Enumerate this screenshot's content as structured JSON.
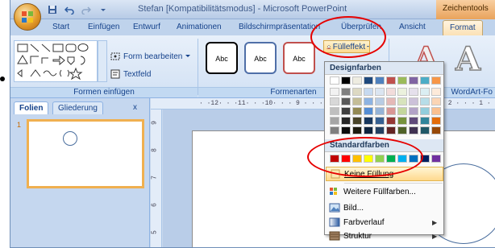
{
  "titlebar": {
    "window_title": "Stefan [Kompatibilitätsmodus] - Microsoft PowerPoint",
    "context_group": "Zeichentools"
  },
  "tabs": [
    "Start",
    "Einfügen",
    "Entwurf",
    "Animationen",
    "Bildschirmpräsentation",
    "Überprüfen",
    "Ansicht",
    "Format"
  ],
  "ribbon": {
    "shapes_group_label": "Formen einfügen",
    "edit_shape": "Form bearbeiten",
    "textbox": "Textfeld",
    "styles_group_label": "Formenarten",
    "style_samples": [
      "Abc",
      "Abc",
      "Abc"
    ],
    "fill_button": "Fülleffekt",
    "wordart_group_label": "WordArt-Fo",
    "wordart_letter": "A"
  },
  "left_pane": {
    "tab_slides": "Folien",
    "tab_outline": "Gliederung",
    "close": "x",
    "slide_number": "1"
  },
  "ruler": {
    "horizontal": "· ·12· · ·11· · ·10· · · 9 · · · 8 ·",
    "horizontal_right": "· · · 2 · · · 1 · ·",
    "vertical": [
      "9",
      "8",
      "7",
      "6",
      "5"
    ]
  },
  "menu": {
    "theme_colors_header": "Designfarben",
    "standard_colors_header": "Standardfarben",
    "no_fill": "Keine Füllung",
    "more_colors": "Weitere Füllfarben...",
    "picture": "Bild...",
    "gradient": "Farbverlauf",
    "texture": "Struktur"
  },
  "theme_colors": [
    [
      "#ffffff",
      "#000000",
      "#eeece1",
      "#1f497d",
      "#4f81bd",
      "#c0504d",
      "#9bbb59",
      "#8064a2",
      "#4bacc6",
      "#f79646"
    ],
    [
      "#f2f2f2",
      "#7f7f7f",
      "#ddd9c3",
      "#c6d9f0",
      "#dbe5f1",
      "#f2dcdb",
      "#ebf1dd",
      "#e5e0ec",
      "#dbeef3",
      "#fdeada"
    ],
    [
      "#d8d8d8",
      "#595959",
      "#c4bd97",
      "#8db3e2",
      "#b8cce4",
      "#e5b9b7",
      "#d7e3bc",
      "#ccc1d9",
      "#b7dde8",
      "#fbd5b5"
    ],
    [
      "#bfbfbf",
      "#3f3f3f",
      "#938953",
      "#548dd4",
      "#95b3d7",
      "#d99694",
      "#c3d69b",
      "#b2a2c7",
      "#92cddc",
      "#fac08f"
    ],
    [
      "#a5a5a5",
      "#262626",
      "#494429",
      "#17365d",
      "#366092",
      "#953734",
      "#76923c",
      "#5f497a",
      "#31859b",
      "#e36c09"
    ],
    [
      "#7f7f7f",
      "#0c0c0c",
      "#1d1b10",
      "#0f243e",
      "#244061",
      "#632423",
      "#4f6128",
      "#3f3151",
      "#205867",
      "#974806"
    ]
  ],
  "standard_colors": [
    "#c00000",
    "#ff0000",
    "#ffc000",
    "#ffff00",
    "#92d050",
    "#00b050",
    "#00b0f0",
    "#0070c0",
    "#002060",
    "#7030a0"
  ],
  "annotation_color": "#e60000"
}
